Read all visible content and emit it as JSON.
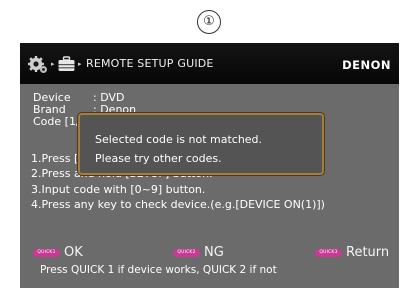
{
  "step_marker": "①",
  "header": {
    "title": "REMOTE SETUP GUIDE",
    "brand": "DENON",
    "breadcrumb_arrow": "▸",
    "icons": [
      "gear-icon",
      "briefcase-icon"
    ]
  },
  "info": {
    "device_label": "Device",
    "device_value": ": DVD",
    "brand_label": "Brand",
    "brand_value": ": Denon",
    "code_label": "Code [1/1]"
  },
  "instructions": [
    "1.Press [DEVICE] button.",
    "2.Press and hold [SETUP] button.",
    "3.Input code with [0~9] button.",
    "4.Press any key to check device.(e.g.[DEVICE ON(1)])"
  ],
  "popup": {
    "line1": "Selected code is not matched.",
    "line2": "Please try other codes."
  },
  "actions": [
    {
      "button": "QUICK1",
      "label": "OK"
    },
    {
      "button": "QUICK2",
      "label": "NG"
    },
    {
      "button": "QUICK3",
      "label": "Return"
    }
  ],
  "hint": "Press QUICK 1 if device works, QUICK 2 if not",
  "colors": {
    "screen_bg": "#6b6b6b",
    "header_bg": "#0b0b0b",
    "popup_border": "#a67e3c",
    "quick_button": "#c83a96"
  }
}
